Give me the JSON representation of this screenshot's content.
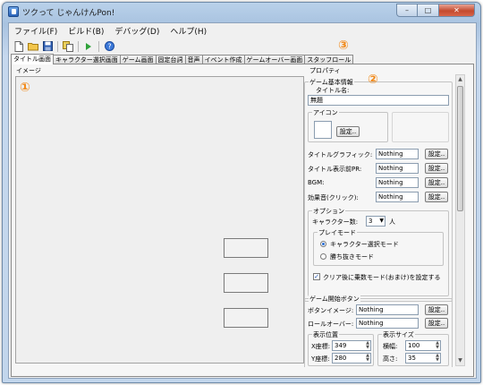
{
  "window": {
    "title": "ツクって じゃんけんPon!",
    "min": "–",
    "max": "□",
    "close": "✕"
  },
  "menu": [
    "ファイル(F)",
    "ビルド(B)",
    "デバッグ(D)",
    "ヘルプ(H)"
  ],
  "toolbar_icons": [
    "new-file-icon",
    "open-folder-icon",
    "save-icon",
    "copy-icon",
    "run-icon",
    "help-icon"
  ],
  "tabs": [
    "タイトル画面",
    "キャラクター選択画面",
    "ゲーム画面",
    "固定台詞",
    "音声",
    "イベント作成",
    "ゲームオーバー画面",
    "スタッフロール"
  ],
  "image_group": {
    "label": "イメージ"
  },
  "markers": {
    "one": "①",
    "two": "②",
    "three": "③"
  },
  "properties": {
    "label": "プロパティ",
    "basic": {
      "legend": "ゲーム基本情報",
      "title_name_label": "タイトル名:",
      "title_name_value": "無題",
      "icon_legend": "アイコン",
      "icon_button": "設定..",
      "rows": [
        {
          "label": "タイトルグラフィック:",
          "value": "Nothing",
          "button": "設定.."
        },
        {
          "label": "タイトル表示前PR:",
          "value": "Nothing",
          "button": "設定.."
        },
        {
          "label": "BGM:",
          "value": "Nothing",
          "button": "設定.."
        },
        {
          "label": "効果音(クリック):",
          "value": "Nothing",
          "button": "設定.."
        }
      ],
      "options": {
        "legend": "オプション",
        "char_count_label": "キャラクター数:",
        "char_count_value": "3",
        "char_count_unit": "人",
        "play_mode_legend": "プレイモード",
        "mode_select": "キャラクター選択モード",
        "mode_win": "勝ち抜きモード",
        "clear_checkbox": "クリア後に乗数モード(おまけ)を設定する"
      }
    },
    "start_button": {
      "legend": "ゲーム開始ボタン",
      "image_label": "ボタンイメージ:",
      "image_value": "Nothing",
      "image_button": "設定..",
      "rollover_label": "ロールオーバー:",
      "rollover_value": "Nothing",
      "rollover_button": "設定..",
      "position_legend": "表示位置",
      "x_label": "X座標:",
      "x_value": "349",
      "y_label": "Y座標:",
      "y_value": "280",
      "size_legend": "表示サイズ",
      "w_label": "横幅:",
      "w_value": "100",
      "h_label": "高さ:",
      "h_value": "35"
    }
  }
}
